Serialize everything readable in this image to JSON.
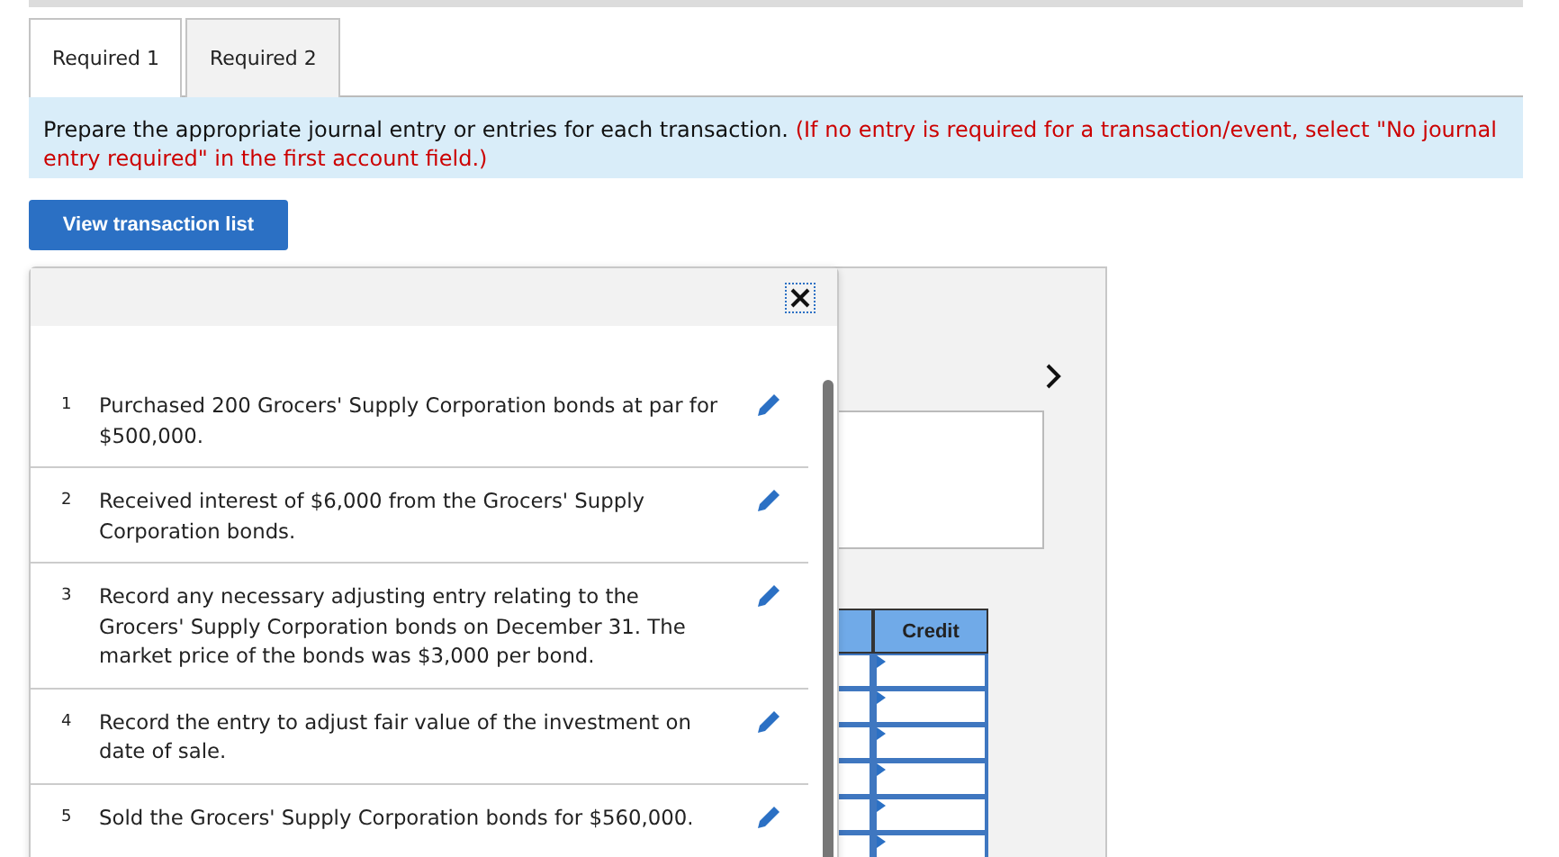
{
  "tabs": [
    {
      "label": "Required 1",
      "selected": true
    },
    {
      "label": "Required 2",
      "selected": false
    }
  ],
  "instructions": {
    "text": "Prepare the appropriate journal entry or entries for each transaction.",
    "note": "(If no entry is required for a transaction/event, select \"No journal entry required\" in the first account field.)"
  },
  "view_button": "View transaction list",
  "transaction_list": {
    "items": [
      {
        "number": "1",
        "text": "Purchased 200 Grocers' Supply Corporation bonds at par for $500,000."
      },
      {
        "number": "2",
        "text": "Received interest of $6,000 from the Grocers' Supply Corporation bonds."
      },
      {
        "number": "3",
        "text": "Record any necessary adjusting entry relating to the Grocers' Supply Corporation bonds on December 31. The market price of the bonds was $3,000 per bond."
      },
      {
        "number": "4",
        "text": "Record the entry to adjust fair value of the investment on date of sale."
      },
      {
        "number": "5",
        "text": "Sold the Grocers' Supply Corporation bonds for $560,000."
      }
    ]
  },
  "journal": {
    "columns": [
      "Credit"
    ]
  }
}
